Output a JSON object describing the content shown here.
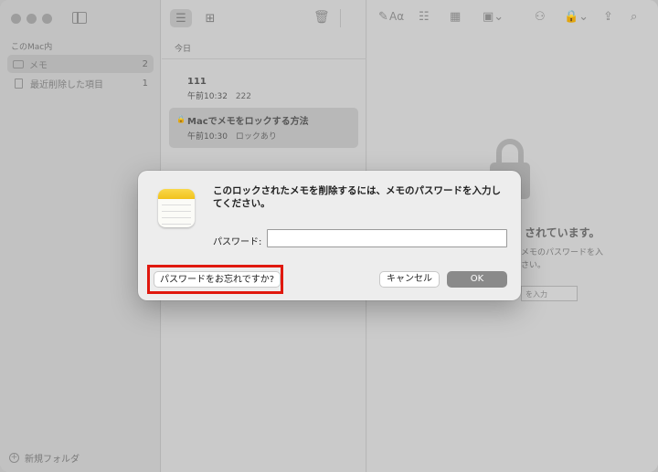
{
  "sidebar": {
    "section_title": "このMac内",
    "folders": [
      {
        "label": "メモ",
        "count": "2"
      },
      {
        "label": "最近削除した項目",
        "count": "1"
      }
    ],
    "new_folder_label": "新規フォルダ"
  },
  "list": {
    "date_header": "今日",
    "notes": [
      {
        "title": "111",
        "time": "午前10:32",
        "preview": "222"
      },
      {
        "title": "Macでメモをロックする方法",
        "time": "午前10:30",
        "preview": "ロックあり"
      }
    ]
  },
  "editor": {
    "font_button": "Aα",
    "locked_title": "されています。",
    "locked_sub": "メモのパスワードを入\nさい。",
    "locked_field_placeholder": "を入力"
  },
  "dialog": {
    "message": "このロックされたメモを削除するには、メモのパスワードを入力してください。",
    "password_label": "パスワード:",
    "password_value": "",
    "forgot_label": "パスワードをお忘れですか?",
    "cancel_label": "キャンセル",
    "ok_label": "OK"
  },
  "colors": {
    "highlight": "#e0180e",
    "ok_button": "#8a8a8a",
    "icon_yellow": "#f1c21c"
  }
}
